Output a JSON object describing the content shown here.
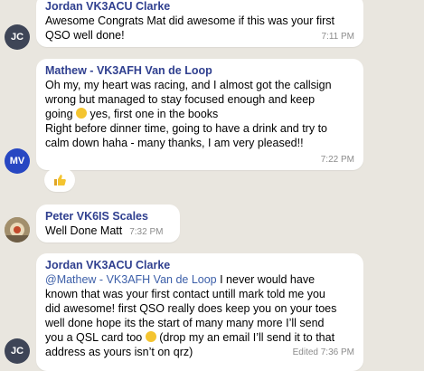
{
  "messages": [
    {
      "sender": "Jordan VK3ACU Clarke",
      "lines": [
        "Awesome Congrats Mat did awesome if this was your first",
        "QSO well done!"
      ],
      "time": "7:11 PM",
      "avatar": "JC"
    },
    {
      "sender": "Mathew - VK3AFH Van de Loop",
      "lines": [
        "Oh my, my heart was racing, and I almost got the callsign",
        "wrong but managed to stay focused enough and keep",
        "going",
        " yes, first one in the books",
        "Right before dinner time, going to have a drink and try to",
        "calm down haha - many thanks, I am very pleased!!"
      ],
      "time": "7:22 PM",
      "avatar": "MV",
      "reaction_icon": "thumbs-up-icon"
    },
    {
      "sender": "Peter VK6IS Scales",
      "lines": [
        "Well Done Matt"
      ],
      "time": "7:32 PM",
      "avatar_icon": "profile-photo"
    },
    {
      "sender": "Jordan VK3ACU Clarke",
      "mention": "@Mathew - VK3AFH Van de Loop",
      "lines": [
        " I never would have",
        "known that was your first contact untill mark told me you",
        "did awesome! first QSO really does keep you on your toes",
        "well done hope its the start of many many more I’ll send",
        "you a QSL card too",
        " (drop my an email I’ll send it to that",
        "address as yours isn’t on qrz)"
      ],
      "edited": "Edited",
      "time": "7:36 PM",
      "avatar": "JC"
    }
  ],
  "colors": {
    "background": "#e9e6df",
    "avatar_jc": "#3e4557",
    "avatar_mv": "#2747c2",
    "sender_name": "#2f3f8f",
    "link": "#3b5ea8",
    "timestamp": "#8c8c8c"
  }
}
